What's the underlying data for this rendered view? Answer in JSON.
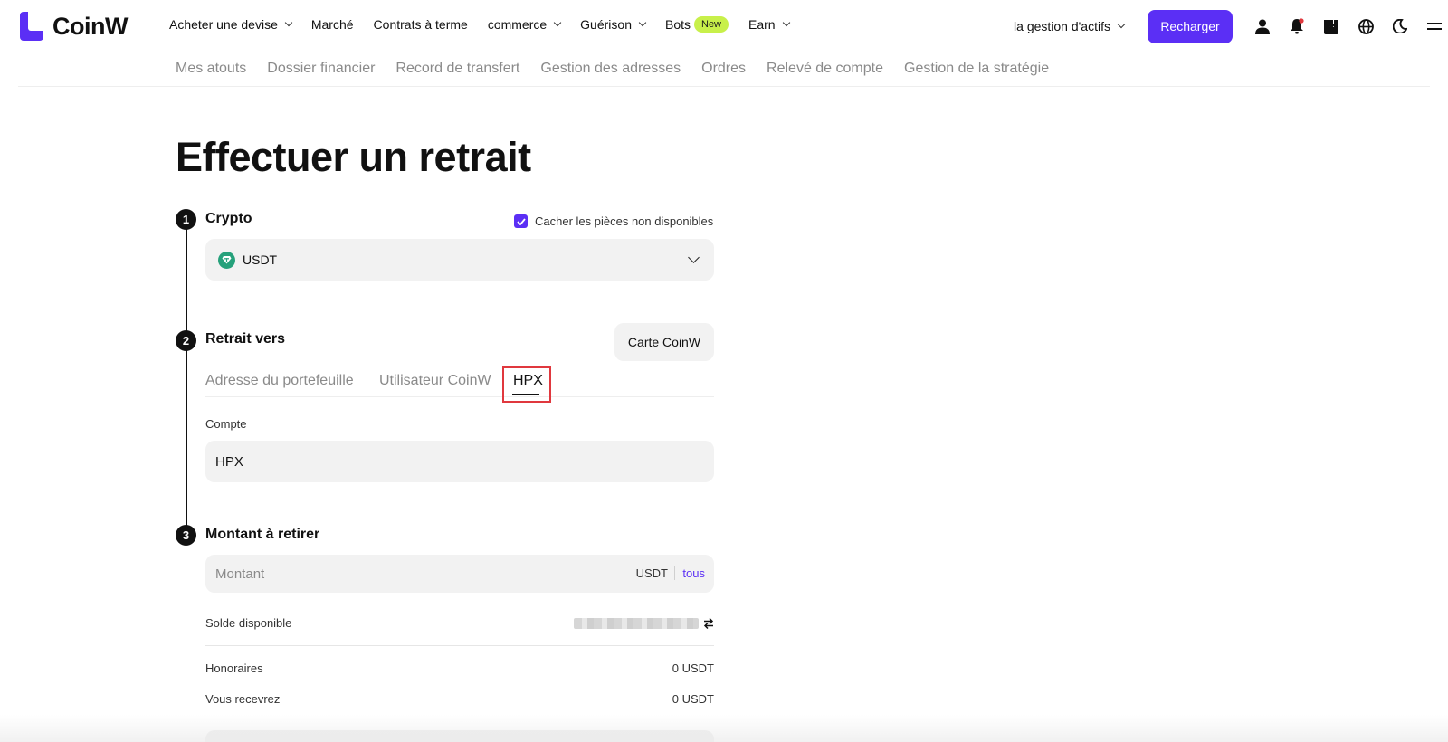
{
  "brand": {
    "name": "CoinW",
    "accent": "#5b2ff5"
  },
  "nav": {
    "items": [
      {
        "label": "Acheter une devise",
        "dropdown": true
      },
      {
        "label": "Marché",
        "dropdown": false
      },
      {
        "label": "Contrats à terme",
        "dropdown": false
      },
      {
        "label": "commerce",
        "dropdown": true
      },
      {
        "label": "Guérison",
        "dropdown": true
      },
      {
        "label": "Bots",
        "badge": "New",
        "dropdown": false
      },
      {
        "label": "Earn",
        "dropdown": true
      }
    ],
    "asset_management": "la gestion d'actifs",
    "recharge": "Recharger",
    "icons": [
      "user-icon",
      "bell-icon",
      "download-icon",
      "globe-icon",
      "moon-icon",
      "menu-icon"
    ]
  },
  "subnav": {
    "items": [
      "Mes atouts",
      "Dossier financier",
      "Record de transfert",
      "Gestion des adresses",
      "Ordres",
      "Relevé de compte",
      "Gestion de la stratégie"
    ]
  },
  "page": {
    "title": "Effectuer un retrait"
  },
  "step1": {
    "number": "1",
    "label": "Crypto",
    "hide_unavailable_label": "Cacher les pièces non disponibles",
    "hide_unavailable_checked": true,
    "selected_coin": "USDT",
    "coin_icon": "tether-icon"
  },
  "step2": {
    "number": "2",
    "label": "Retrait vers",
    "card_button": "Carte CoinW",
    "tabs": [
      "Adresse du portefeuille",
      "Utilisateur CoinW",
      "HPX"
    ],
    "active_tab": "HPX",
    "account_label": "Compte",
    "account_value": "HPX"
  },
  "step3": {
    "number": "3",
    "label": "Montant à retirer",
    "amount_placeholder": "Montant",
    "amount_unit": "USDT",
    "all_label": "tous",
    "available_label": "Solde disponible",
    "fees_label": "Honoraires",
    "fees_value": "0 USDT",
    "receive_label": "Vous recevrez",
    "receive_value": "0 USDT"
  }
}
